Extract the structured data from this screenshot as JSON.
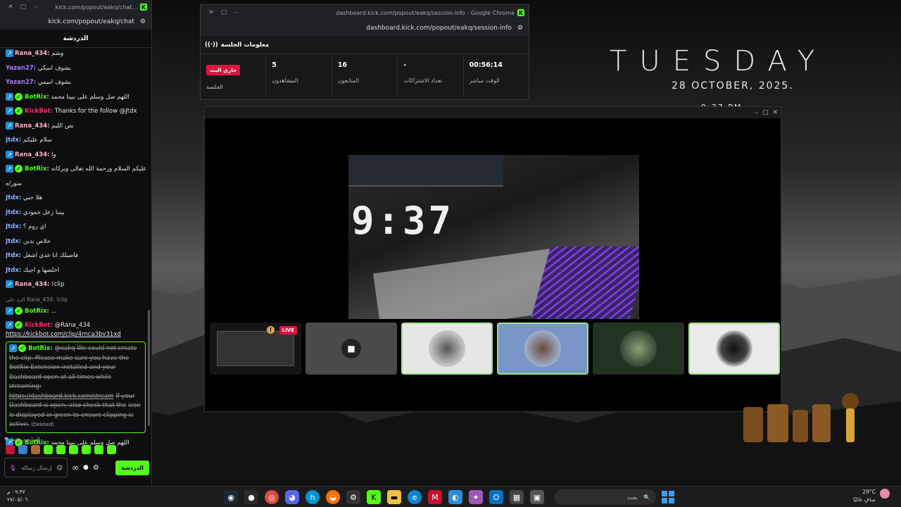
{
  "desktop": {
    "day": "TUESDAY",
    "date": "28  OCTOBER, 2025.",
    "time": "9:37 PM"
  },
  "chat_window": {
    "title": "kick.com/popout/eakq/chat...",
    "url": "kick.com/popout/eakq/chat",
    "header": "الدردشة",
    "messages": [
      {
        "user": "Rana_434:",
        "text": "وشم",
        "type": "rana"
      },
      {
        "user": "Yazan27:",
        "text": "بشوف اسكي",
        "type": "yazan"
      },
      {
        "user": "Yazan27:",
        "text": "بشوف اسمي",
        "type": "yazan"
      },
      {
        "user": "BotRix:",
        "text": "اللهم صل وسلم على نبينا محمد",
        "type": "botrix"
      },
      {
        "user": "KickBot:",
        "text": "Thanks for the follow @Jtdx",
        "type": "kickbot"
      },
      {
        "user": "Rana_434:",
        "text": "نص الليم",
        "type": "rana"
      },
      {
        "user": "Jtdx:",
        "text": "سلام عليكم",
        "type": "jtdx"
      },
      {
        "user": "Rana_434:",
        "text": "وا",
        "type": "rana"
      },
      {
        "user": "BotRix:",
        "text": "وعليكم السلام ورحمة الله تعالى وبركاته",
        "type": "botrix"
      },
      {
        "user": "",
        "text": "منور/ه",
        "type": "cont"
      },
      {
        "user": "Jtdx:",
        "text": "هلا حبي",
        "type": "jtdx"
      },
      {
        "user": "Jtdx:",
        "text": "بيتنا زعل حمودي",
        "type": "jtdx"
      },
      {
        "user": "Jtdx:",
        "text": "اي روم ؟",
        "type": "jtdx"
      },
      {
        "user": "Jtdx:",
        "text": "خلاص بدين",
        "type": "jtdx"
      },
      {
        "user": "Jtdx:",
        "text": "فاضيلك انا عدي اشغل",
        "type": "jtdx"
      },
      {
        "user": "Jtdx:",
        "text": "اخلصها و اجيك",
        "type": "jtdx"
      },
      {
        "user": "Rana_434:",
        "text": "!clip",
        "type": "rana"
      }
    ],
    "reply_note": "الرد على Rana_434: !clip",
    "botrix_reply": {
      "user": "BotRix:",
      "text": "..."
    },
    "kickbot_reply": {
      "user": "KickBot:",
      "text": "@Rana_434",
      "link": "https://kickbot.com/clip/4rnca3bv31xd"
    },
    "deleted_message": {
      "user": "BotRix:",
      "text": "@eakq We could not create the clip. Please make sure you have the BotRix Extension installed and your Dashboard open at all times while streaming:",
      "link": "https://dashboard.kick.com/stream",
      "text2": "If your Dashboard is open, also check that the",
      "text3": "icon is displayed in green to ensure clipping is active.",
      "tag": "(Deleted)"
    },
    "last_message": {
      "user": "BotRix:",
      "text": "اللهم صل وسلم على نبينا محمد"
    },
    "followers_only": "المتابعون فقط",
    "input_placeholder": "إرسال رسالة",
    "send_label": "الدردشة"
  },
  "session_window": {
    "title": "dashboard.kick.com/popout/eakq/session-info - Google Chrome",
    "url": "dashboard.kick.com/popout/eakq/session-info",
    "header": "معلومات الجلسة",
    "stats": [
      {
        "value": "00:56:14",
        "label": "الوقت مباشر"
      },
      {
        "value": "-",
        "label": "تعداد الاشتراكات"
      },
      {
        "value": "16",
        "label": "المتابعون"
      },
      {
        "value": "5",
        "label": "المشاهدون"
      },
      {
        "value": "جاري البث",
        "label": "الجلسة",
        "badge": true
      }
    ]
  },
  "video_window": {
    "live_label": "LIVE",
    "clock_text": "9:37"
  },
  "taskbar": {
    "clock_time": "٠٩:٣٧ م",
    "clock_date": "٢٧/٠٥/٠٦",
    "search_placeholder": "بحث",
    "weather_temp": "29°C",
    "weather_desc": "صافٍ غالبًا"
  }
}
